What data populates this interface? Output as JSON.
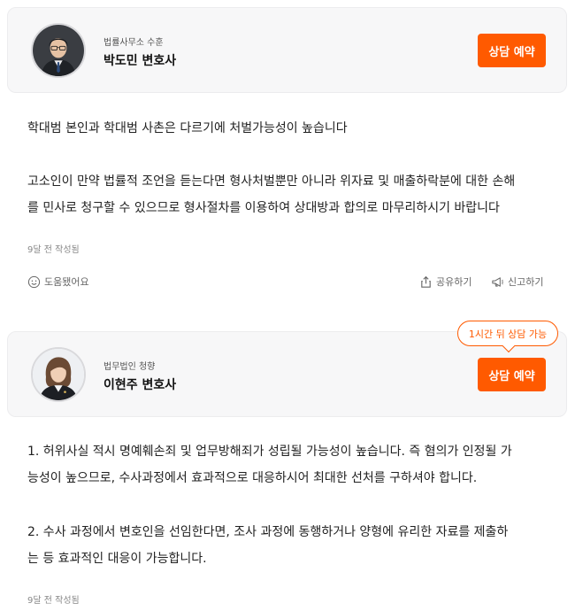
{
  "answers": [
    {
      "firm": "법률사무소 수훈",
      "lawyer": "박도민 변호사",
      "consult_label": "상담 예약",
      "paragraphs": [
        [
          "학대범 본인과 학대범 사촌은 다르기에 처벌가능성이 높습니다"
        ],
        [
          "고소인이 만약 법률적 조언을 듣는다면 형사처벌뿐만 아니라 위자료 및 매출하락분에 대한 손해",
          "를 민사로 청구할 수 있으므로 형사절차를 이용하여 상대방과 합의로 마무리하시기 바랍니다"
        ]
      ],
      "written": "9달 전 작성됨",
      "helpful_label": "도움됐어요",
      "share_label": "공유하기",
      "report_label": "신고하기"
    },
    {
      "firm": "법무법인 청향",
      "lawyer": "이현주 변호사",
      "consult_label": "상담 예약",
      "availability": "1시간 뒤 상담 가능",
      "paragraphs": [
        [
          "1. 허위사실 적시 명예훼손죄 및 업무방해죄가 성립될 가능성이 높습니다. 즉 혐의가 인정될 가",
          "능성이 높으므로, 수사과정에서 효과적으로 대응하시어 최대한 선처를 구하셔야 합니다."
        ],
        [
          "2. 수사 과정에서 변호인을 선임한다면, 조사 과정에 동행하거나 양형에 유리한 자료를 제출하",
          "는 등 효과적인 대응이 가능합니다."
        ]
      ],
      "written": "9달 전 작성됨"
    }
  ],
  "colors": {
    "accent": "#ff5a00",
    "card_bg": "#f7f7f8",
    "meta_text": "#888888"
  },
  "icons": {
    "helpful": "smile-icon",
    "share": "share-icon",
    "report": "megaphone-icon"
  }
}
